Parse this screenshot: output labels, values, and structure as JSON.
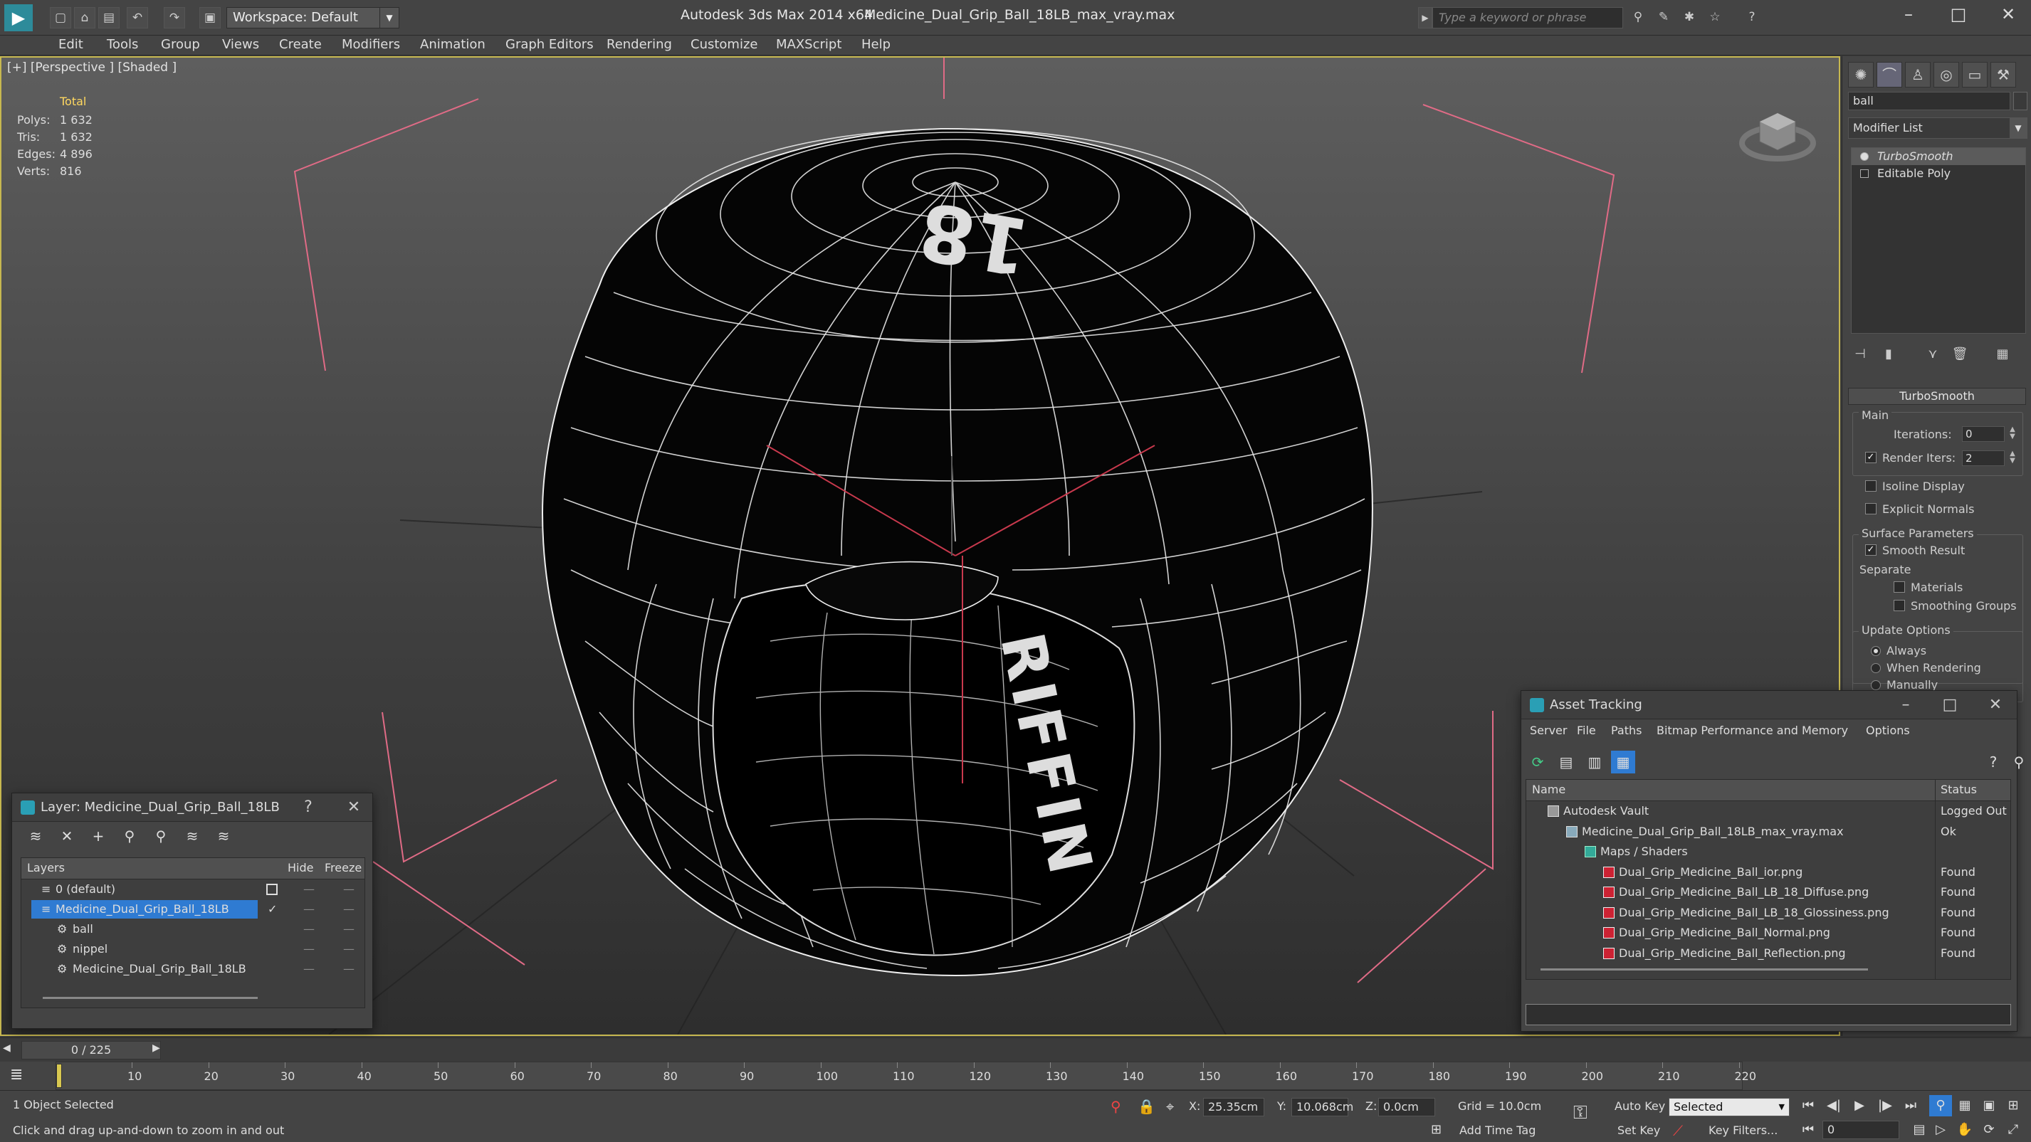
{
  "app": {
    "title": "Autodesk 3ds Max  2014 x64",
    "filename": "Medicine_Dual_Grip_Ball_18LB_max_vray.max",
    "workspace": "Workspace: Default",
    "search_placeholder": "Type a keyword or phrase"
  },
  "menu": [
    "Edit",
    "Tools",
    "Group",
    "Views",
    "Create",
    "Modifiers",
    "Animation",
    "Graph Editors",
    "Rendering",
    "Customize",
    "MAXScript",
    "Help"
  ],
  "viewport": {
    "label": "[+] [Perspective ] [Shaded ]",
    "stats": {
      "header": "Total",
      "rows": [
        {
          "k": "Polys:",
          "v": "1 632"
        },
        {
          "k": "Tris:",
          "v": "1 632"
        },
        {
          "k": "Edges:",
          "v": "4 896"
        },
        {
          "k": "Verts:",
          "v": "816"
        }
      ]
    },
    "ball_text_top": "18",
    "ball_text_side": "RIFFIN"
  },
  "command_panel": {
    "object_name": "ball",
    "modifier_list": "Modifier List",
    "stack": [
      "TurboSmooth",
      "Editable Poly"
    ],
    "rollout": "TurboSmooth",
    "main_label": "Main",
    "iterations_label": "Iterations:",
    "iterations_value": "0",
    "render_iters_label": "Render Iters:",
    "render_iters_value": "2",
    "isoline": "Isoline Display",
    "explicit_normals": "Explicit Normals",
    "surface_params": "Surface Parameters",
    "smooth_result": "Smooth Result",
    "separate": "Separate",
    "materials": "Materials",
    "smoothing_groups": "Smoothing Groups",
    "update_options": "Update Options",
    "always": "Always",
    "when_rendering": "When Rendering",
    "manually": "Manually"
  },
  "layer_window": {
    "title": "Layer: Medicine_Dual_Grip_Ball_18LB",
    "help": "?",
    "columns": [
      "Layers",
      "Hide",
      "Freeze"
    ],
    "rows": [
      {
        "name": "0 (default)",
        "level": 0
      },
      {
        "name": "Medicine_Dual_Grip_Ball_18LB",
        "level": 0,
        "selected": true
      },
      {
        "name": "ball",
        "level": 1
      },
      {
        "name": "nippel",
        "level": 1
      },
      {
        "name": "Medicine_Dual_Grip_Ball_18LB",
        "level": 1
      }
    ]
  },
  "asset_window": {
    "title": "Asset Tracking",
    "menu": [
      "Server",
      "File",
      "Paths",
      "Bitmap Performance and Memory",
      "Options"
    ],
    "columns": [
      "Name",
      "Status"
    ],
    "rows": [
      {
        "name": "Autodesk Vault",
        "status": "Logged Out",
        "level": 0,
        "icon": "vault"
      },
      {
        "name": "Medicine_Dual_Grip_Ball_18LB_max_vray.max",
        "status": "Ok",
        "level": 1,
        "icon": "max"
      },
      {
        "name": "Maps / Shaders",
        "status": "",
        "level": 2,
        "icon": "fold"
      },
      {
        "name": "Dual_Grip_Medicine_Ball_ior.png",
        "status": "Found",
        "level": 3,
        "icon": "png"
      },
      {
        "name": "Dual_Grip_Medicine_Ball_LB_18_Diffuse.png",
        "status": "Found",
        "level": 3,
        "icon": "png"
      },
      {
        "name": "Dual_Grip_Medicine_Ball_LB_18_Glossiness.png",
        "status": "Found",
        "level": 3,
        "icon": "png"
      },
      {
        "name": "Dual_Grip_Medicine_Ball_Normal.png",
        "status": "Found",
        "level": 3,
        "icon": "png"
      },
      {
        "name": "Dual_Grip_Medicine_Ball_Reflection.png",
        "status": "Found",
        "level": 3,
        "icon": "png"
      }
    ]
  },
  "timeline": {
    "frame": "0 / 225",
    "ticks": [
      "10",
      "20",
      "30",
      "40",
      "50",
      "60",
      "70",
      "80",
      "90",
      "100",
      "110",
      "120",
      "130",
      "140",
      "150",
      "160",
      "170",
      "180",
      "190",
      "200",
      "210",
      "220"
    ]
  },
  "status": {
    "selection": "1 Object Selected",
    "prompt": "Click and drag up-and-down to zoom in and out",
    "x_label": "X:",
    "x": "25.35cm",
    "y_label": "Y:",
    "y": "10.068cm",
    "z_label": "Z:",
    "z": "0.0cm",
    "grid": "Grid = 10.0cm",
    "add_time_tag": "Add Time Tag",
    "auto_key": "Auto Key",
    "set_key": "Set Key",
    "selected": "Selected",
    "key_filters": "Key Filters...",
    "frame_field": "0"
  }
}
